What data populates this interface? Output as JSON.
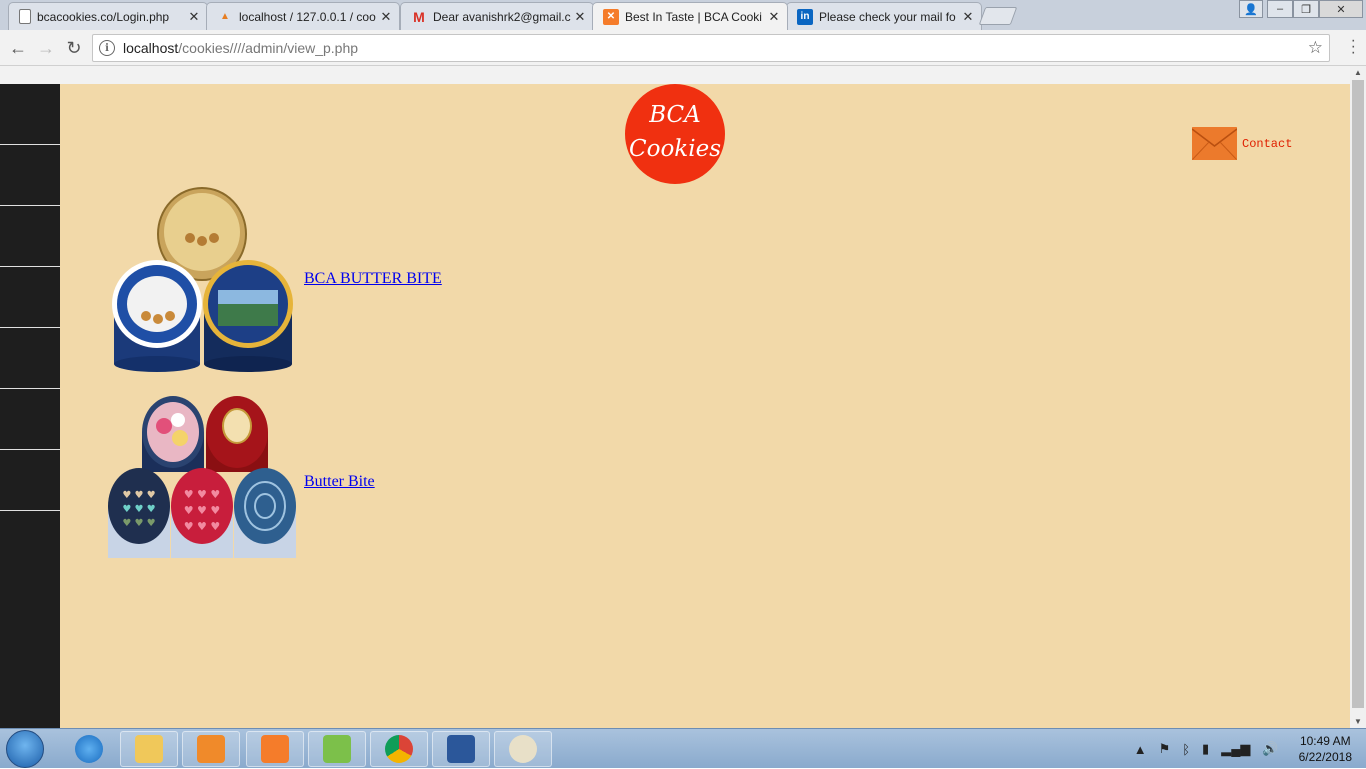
{
  "browser": {
    "tabs": [
      {
        "title": "bcacookies.co/Login.php",
        "icon": "page-icon"
      },
      {
        "title": "localhost / 127.0.0.1 / coo",
        "icon": "phpmyadmin-icon"
      },
      {
        "title": "Dear avanishrk2@gmail.c",
        "icon": "gmail-icon"
      },
      {
        "title": "Best In Taste | BCA Cooki",
        "icon": "xampp-icon"
      },
      {
        "title": "Please check your mail fo",
        "icon": "linkedin-icon"
      }
    ],
    "active_tab": 3,
    "url_host": "localhost",
    "url_path": "/cookies////admin/view_p.php"
  },
  "page": {
    "logo_line1": "BCA",
    "logo_line2": "Cookies",
    "contact_label": "Contact",
    "products": [
      {
        "name": "BCA BUTTER BITE"
      },
      {
        "name": "Butter Bite"
      }
    ]
  },
  "taskbar": {
    "time": "10:49 AM",
    "date": "6/22/2018"
  },
  "colors": {
    "page_bg": "#f2d9a9",
    "sidebar_bg": "#1e1e1e",
    "logo_bg": "#f03010",
    "contact_text": "#e02000",
    "link": "#0000ee"
  }
}
